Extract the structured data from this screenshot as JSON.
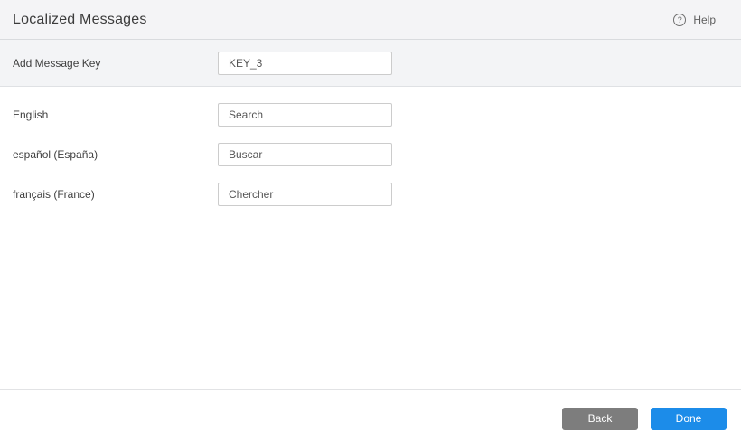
{
  "header": {
    "title": "Localized Messages",
    "help": {
      "icon": "question-mark-circle-icon",
      "label": "Help",
      "glyph": "?"
    }
  },
  "key_section": {
    "label": "Add Message Key",
    "value": "KEY_3"
  },
  "languages": [
    {
      "label": "English",
      "value": "Search"
    },
    {
      "label": "español (España)",
      "value": "Buscar"
    },
    {
      "label": "français (France)",
      "value": "Chercher"
    }
  ],
  "footer": {
    "back_label": "Back",
    "done_label": "Done"
  },
  "colors": {
    "header_bg": "#f4f4f6",
    "section_bg": "#f3f4f6",
    "divider": "#dfe1e4",
    "input_border": "#cccccc",
    "back_button": "#7d7d7d",
    "done_button": "#1c8ce9",
    "title_text": "#3c3c3c",
    "label_text": "#3f3f3f"
  }
}
